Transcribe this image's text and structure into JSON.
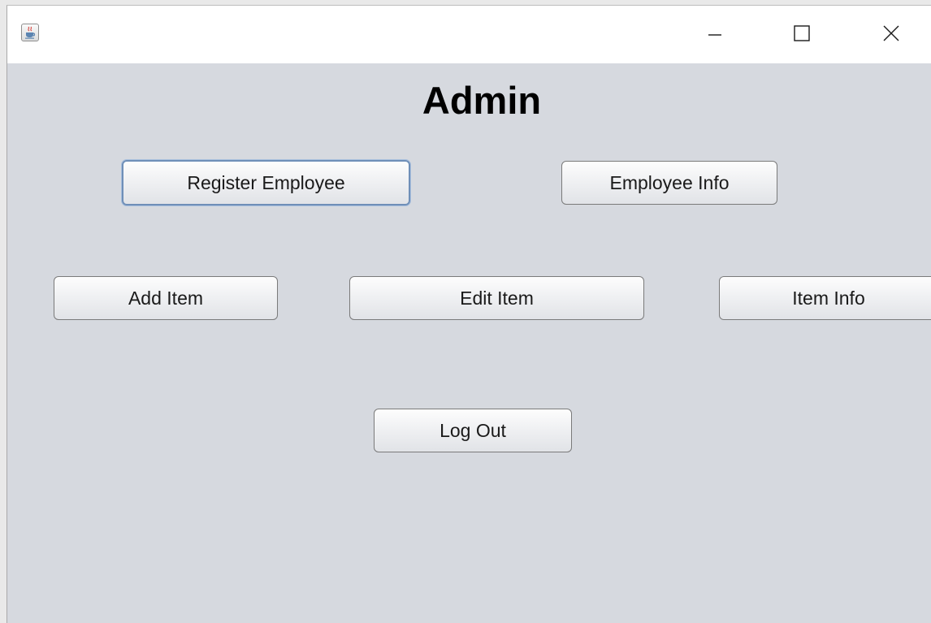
{
  "window": {
    "controls": {
      "minimize": "minimize-icon",
      "maximize": "maximize-icon",
      "close": "close-icon"
    },
    "app_icon": "java-coffee-icon"
  },
  "main": {
    "title": "Admin",
    "buttons": {
      "register_employee": "Register Employee",
      "employee_info": "Employee Info",
      "add_item": "Add Item",
      "edit_item": "Edit Item",
      "item_info": "Item Info",
      "log_out": "Log Out"
    },
    "focused_button": "Register Employee"
  },
  "colors": {
    "content_background": "#d6d9df",
    "titlebar_background": "#ffffff",
    "focus_border": "#6f8fb8"
  }
}
